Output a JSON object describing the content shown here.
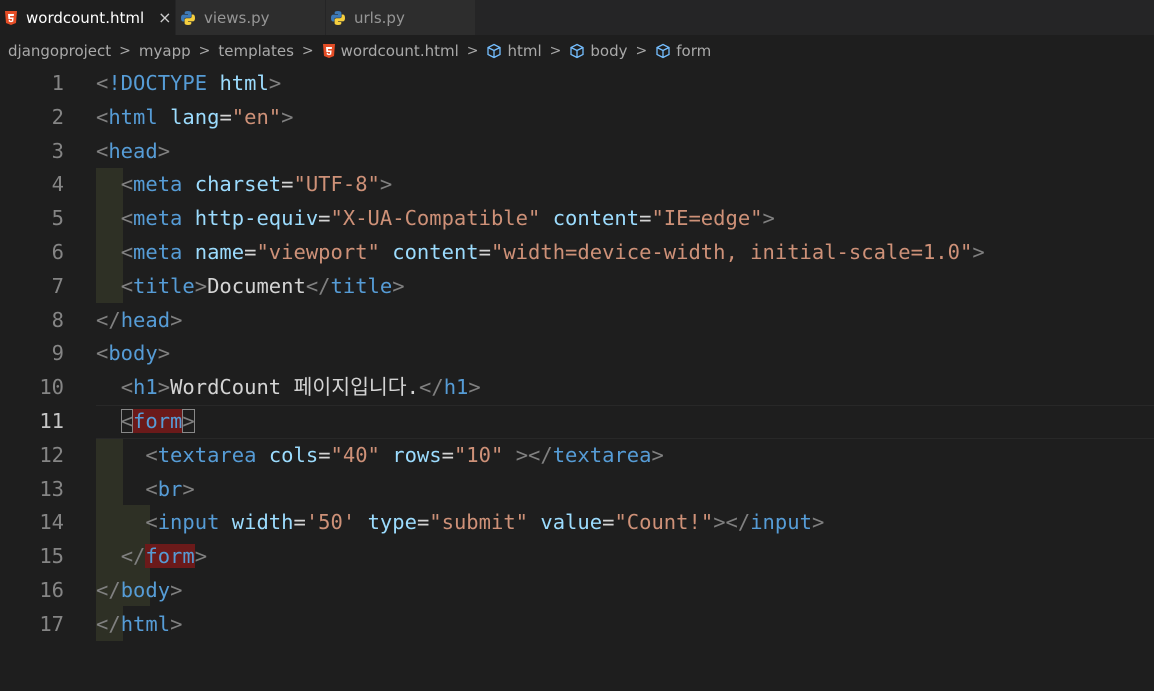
{
  "tabs": [
    {
      "label": "wordcount.html",
      "icon": "html5-icon",
      "active": true,
      "close": "×"
    },
    {
      "label": "views.py",
      "icon": "python-icon",
      "active": false
    },
    {
      "label": "urls.py",
      "icon": "python-icon",
      "active": false
    }
  ],
  "breadcrumb": {
    "items": [
      "djangoproject",
      "myapp",
      "templates",
      "wordcount.html",
      "html",
      "body",
      "form"
    ],
    "separator": ">"
  },
  "editor": {
    "current_line": 11,
    "lines": [
      {
        "n": "1"
      },
      {
        "n": "2"
      },
      {
        "n": "3"
      },
      {
        "n": "4"
      },
      {
        "n": "5"
      },
      {
        "n": "6"
      },
      {
        "n": "7"
      },
      {
        "n": "8"
      },
      {
        "n": "9"
      },
      {
        "n": "10"
      },
      {
        "n": "11"
      },
      {
        "n": "12"
      },
      {
        "n": "13"
      },
      {
        "n": "14"
      },
      {
        "n": "15"
      },
      {
        "n": "16"
      },
      {
        "n": "17"
      }
    ],
    "tokens": {
      "doctype": "!DOCTYPE",
      "html": "html",
      "head": "head",
      "meta": "meta",
      "title": "title",
      "body": "body",
      "h1": "h1",
      "form": "form",
      "textarea": "textarea",
      "br": "br",
      "input": "input",
      "lang": "lang",
      "lang_val": "\"en\"",
      "charset": "charset",
      "charset_val": "\"UTF-8\"",
      "http_equiv": "http-equiv",
      "http_equiv_val": "\"X-UA-Compatible\"",
      "content": "content",
      "ie_val": "\"IE=edge\"",
      "name": "name",
      "viewport_val": "\"viewport\"",
      "viewport_content": "\"width=device-width, initial-scale=1.0\"",
      "title_text": "Document",
      "h1_text": "WordCount 페이지입니다.",
      "cols": "cols",
      "cols_val": "\"40\"",
      "rows": "rows",
      "rows_val": "\"10\"",
      "width": "width",
      "width_val": "'50'",
      "type": "type",
      "type_val": "\"submit\"",
      "value": "value",
      "value_val": "\"Count!\""
    }
  },
  "colors": {
    "background": "#1e1e1e",
    "tag": "#569cd6",
    "attribute": "#9cdcfe",
    "string": "#ce9178",
    "bracket": "#808080",
    "match_highlight": "#6b1a1a"
  }
}
